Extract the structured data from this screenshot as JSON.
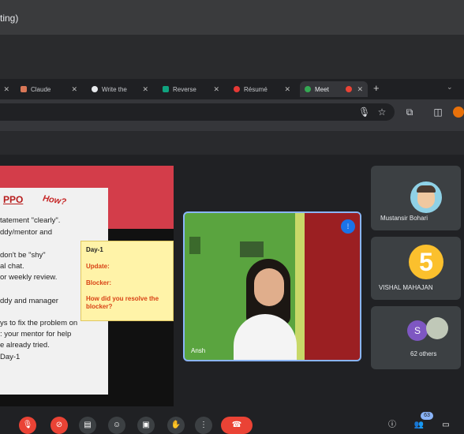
{
  "window": {
    "title_fragment": "ting)"
  },
  "tabs": [
    {
      "label": "",
      "favicon_color": "#9aa0a6"
    },
    {
      "label": "Claude",
      "favicon_color": "#d97757"
    },
    {
      "label": "Write the",
      "favicon_color": "#e8eaed"
    },
    {
      "label": "Reverse",
      "favicon_color": "#10a37f"
    },
    {
      "label": "Résumé",
      "favicon_color": "#e53935"
    },
    {
      "label": "Meet",
      "favicon_color": "#34a853",
      "active": true
    }
  ],
  "toolbar_icons": [
    "mic-icon",
    "star-icon",
    "extensions-icon",
    "sidepanel-icon"
  ],
  "slide": {
    "title": "PPO",
    "how": "How?",
    "lines": [
      "tatement \"clearly\".",
      "ddy/mentor and",
      "don't be \"shy\"",
      "al chat.",
      "or weekly review.",
      "ddy and manager",
      "ys to fix the problem on",
      ": your mentor for help",
      "e already tried.",
      "Day-1"
    ],
    "sticky": {
      "day": "Day-1",
      "update": "Update:",
      "blocker": "Blocker:",
      "question": "How did you resolve the blocker?"
    }
  },
  "presenter": {
    "name": "Ansh"
  },
  "participants": [
    {
      "name": "Mustansir Bohari"
    },
    {
      "name": "VISHAL MAHAJAN",
      "avatar_text": "5"
    },
    {
      "name": "62 others",
      "avatar_letter": "S"
    }
  ],
  "people_count": "63",
  "colors": {
    "accent": "#8ab4f8",
    "hangup": "#ea4335",
    "tile": "#3c4043"
  }
}
